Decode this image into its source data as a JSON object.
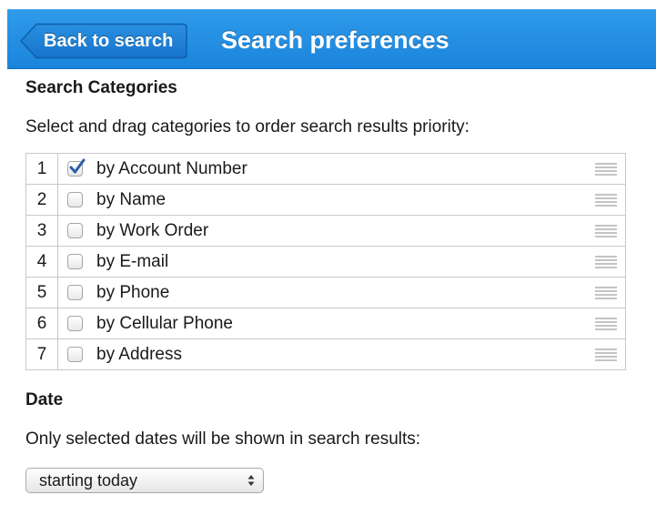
{
  "header": {
    "back_label": "Back to search",
    "title": "Search preferences",
    "bg_color": "#1a84dc"
  },
  "categories": {
    "heading": "Search Categories",
    "description": "Select and drag categories to order search results priority:",
    "rows": [
      {
        "num": "1",
        "label": "by Account Number",
        "checked": true
      },
      {
        "num": "2",
        "label": "by Name",
        "checked": false
      },
      {
        "num": "3",
        "label": "by Work Order",
        "checked": false
      },
      {
        "num": "4",
        "label": "by E-mail",
        "checked": false
      },
      {
        "num": "5",
        "label": "by Phone",
        "checked": false
      },
      {
        "num": "6",
        "label": "by Cellular Phone",
        "checked": false
      },
      {
        "num": "7",
        "label": "by Address",
        "checked": false
      }
    ]
  },
  "date": {
    "heading": "Date",
    "description": "Only selected dates will be shown in search results:",
    "selected": "starting today"
  },
  "icons": {
    "check": "checkmark-icon",
    "drag": "drag-handle-icon",
    "select": "select-arrows-icon"
  },
  "colors": {
    "check_color": "#2c5fa8"
  }
}
